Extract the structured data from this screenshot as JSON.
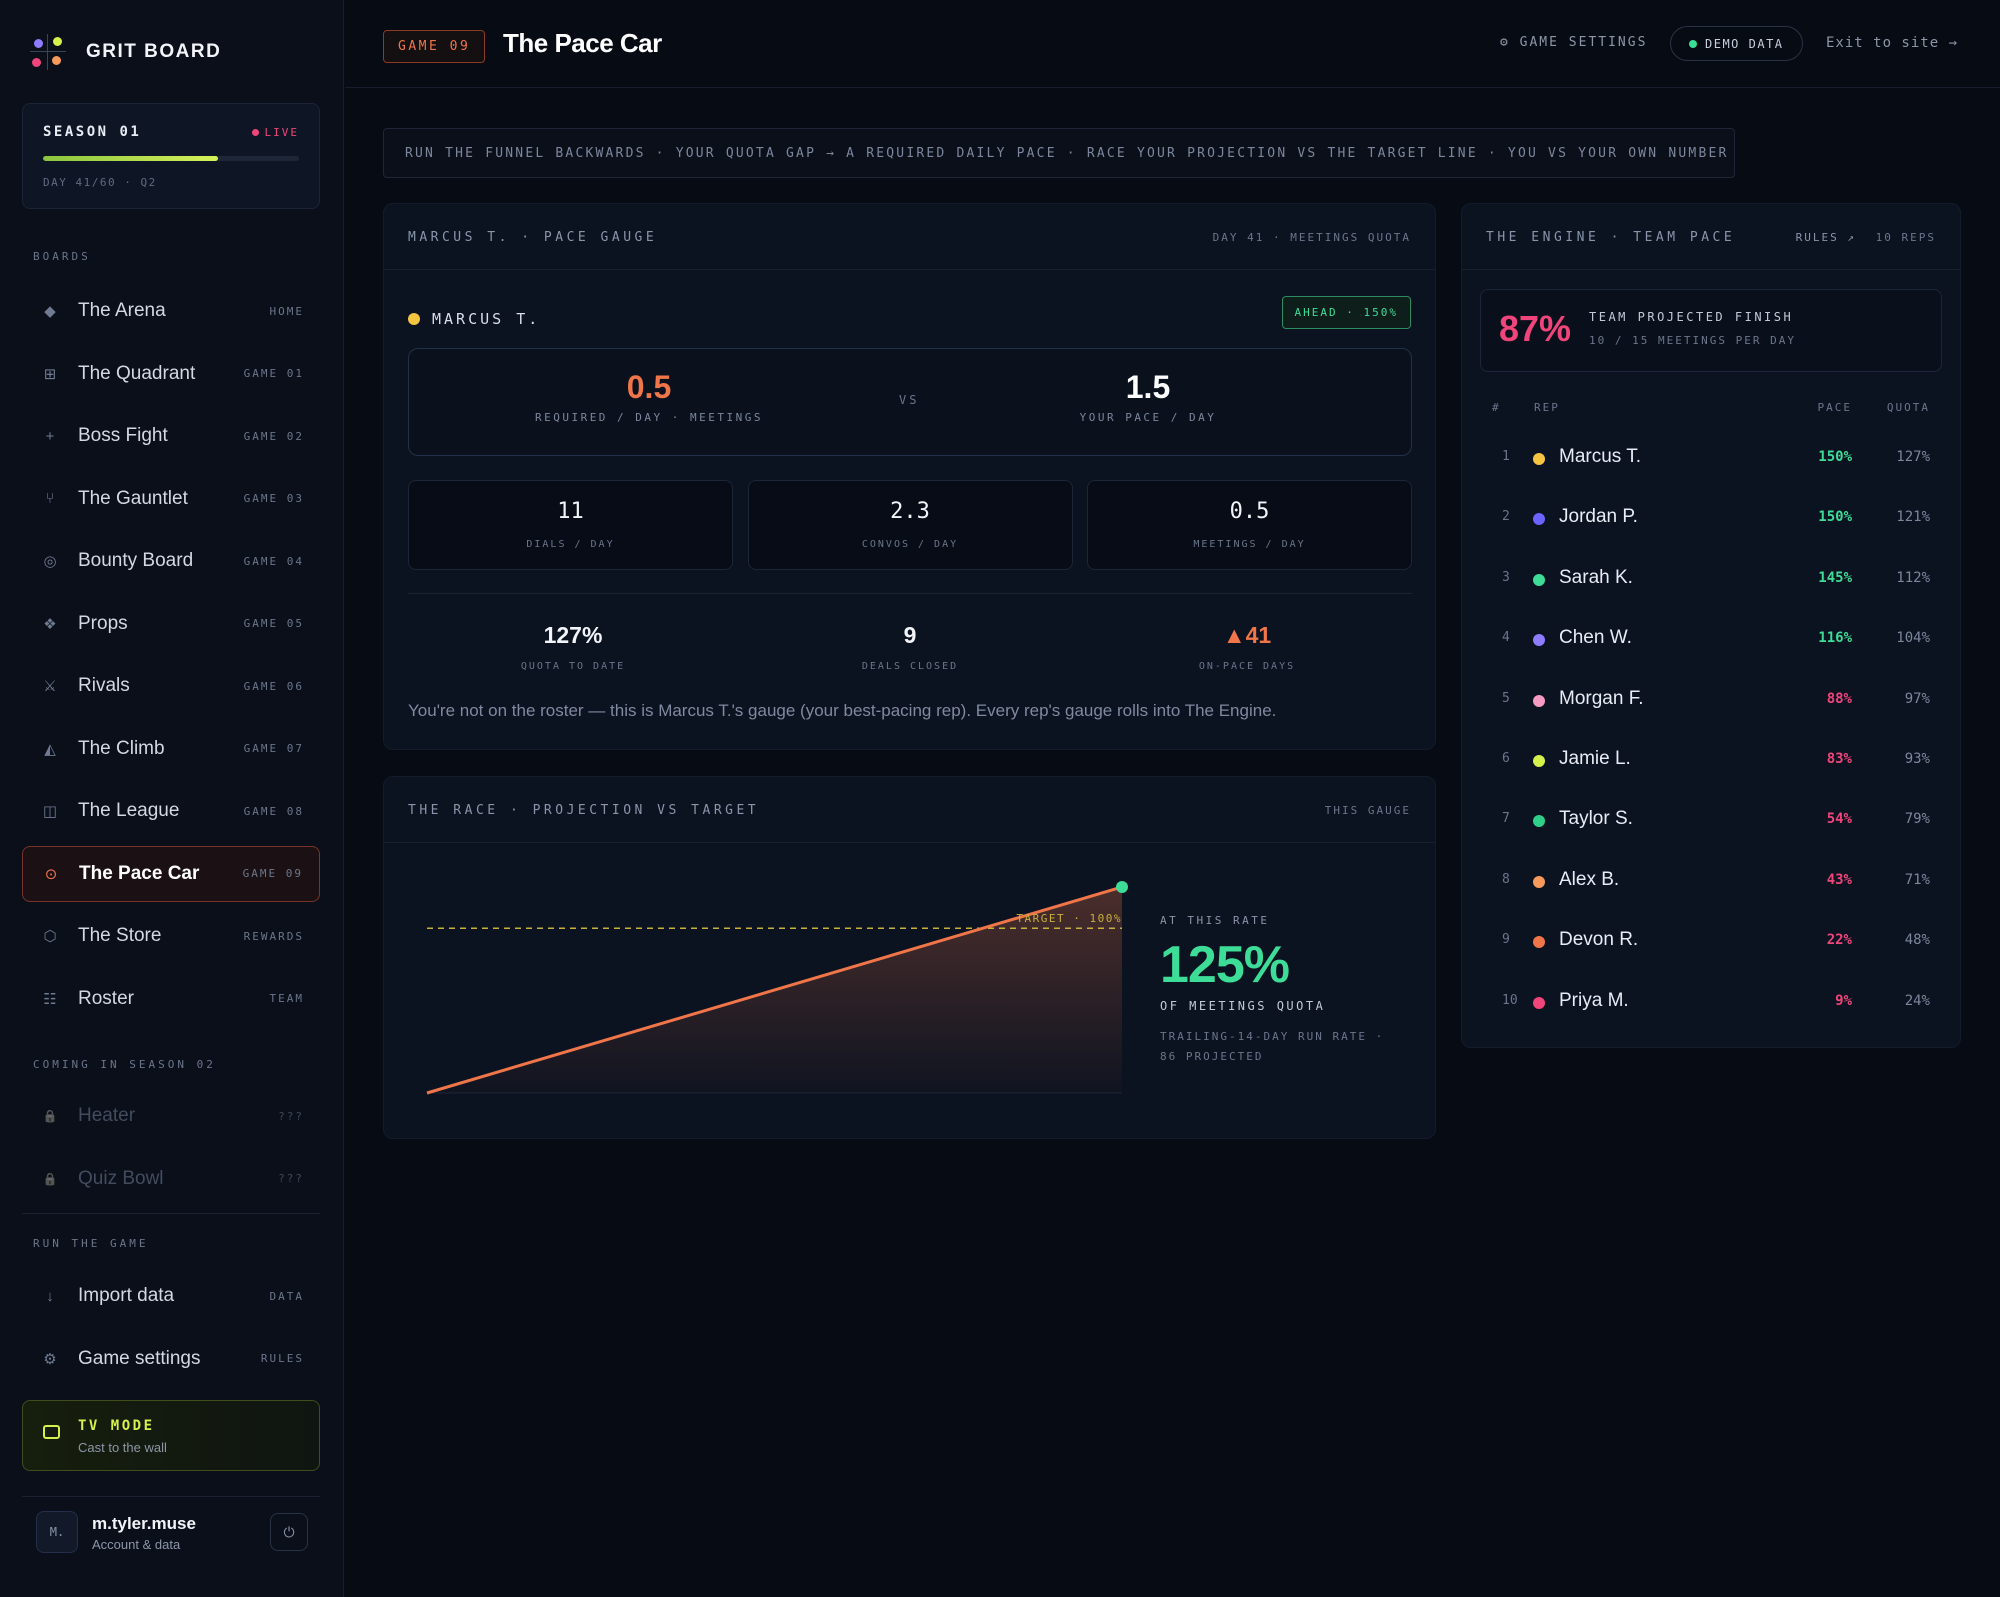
{
  "brand": {
    "name": "GRIT BOARD"
  },
  "season": {
    "title": "SEASON 01",
    "status": "LIVE",
    "progress": 0.683,
    "sub": "DAY 41/60 · Q2"
  },
  "sidebar": {
    "boards_label": "BOARDS",
    "items": [
      {
        "icon": "◆",
        "icon_name": "diamond-icon",
        "label": "The Arena",
        "tag": "HOME"
      },
      {
        "icon": "⊞",
        "icon_name": "grid-icon",
        "label": "The Quadrant",
        "tag": "GAME 01"
      },
      {
        "icon": "+",
        "icon_name": "crosshair-icon",
        "label": "Boss Fight",
        "tag": "GAME 02"
      },
      {
        "icon": "⑂",
        "icon_name": "fork-icon",
        "label": "The Gauntlet",
        "tag": "GAME 03"
      },
      {
        "icon": "◎",
        "icon_name": "target-icon",
        "label": "Bounty Board",
        "tag": "GAME 04"
      },
      {
        "icon": "❖",
        "icon_name": "props-icon",
        "label": "Props",
        "tag": "GAME 05"
      },
      {
        "icon": "⚔",
        "icon_name": "swords-icon",
        "label": "Rivals",
        "tag": "GAME 06"
      },
      {
        "icon": "◭",
        "icon_name": "mountain-icon",
        "label": "The Climb",
        "tag": "GAME 07"
      },
      {
        "icon": "◫",
        "icon_name": "league-icon",
        "label": "The League",
        "tag": "GAME 08"
      },
      {
        "icon": "⊙",
        "icon_name": "speedometer-icon",
        "label": "The Pace Car",
        "tag": "GAME 09"
      },
      {
        "icon": "⬡",
        "icon_name": "store-icon",
        "label": "The Store",
        "tag": "REWARDS"
      },
      {
        "icon": "☷",
        "icon_name": "roster-icon",
        "label": "Roster",
        "tag": "TEAM"
      }
    ],
    "coming_label": "COMING IN SEASON 02",
    "locked": [
      {
        "label": "Heater",
        "tag": "???"
      },
      {
        "label": "Quiz Bowl",
        "tag": "???"
      }
    ],
    "run_label": "RUN THE GAME",
    "run_items": [
      {
        "icon": "↓",
        "icon_name": "download-icon",
        "label": "Import data",
        "tag": "DATA"
      },
      {
        "icon": "⚙",
        "icon_name": "gear-icon",
        "label": "Game settings",
        "tag": "RULES"
      }
    ],
    "tv": {
      "title": "TV MODE",
      "sub": "Cast to the wall"
    },
    "user": {
      "initials": "M.",
      "name": "m.tyler.muse",
      "sub": "Account & data"
    }
  },
  "topbar": {
    "game_badge": "GAME 09",
    "title": "The Pace Car",
    "settings": "⚙ GAME SETTINGS",
    "demo": "DEMO DATA",
    "exit": "Exit to site →"
  },
  "banner": "RUN THE FUNNEL BACKWARDS · YOUR QUOTA GAP → A REQUIRED DAILY PACE · RACE YOUR PROJECTION VS THE TARGET LINE · YOU VS YOUR OWN NUMBER",
  "gauge": {
    "title": "MARCUS T. · PACE GAUGE",
    "meta": "DAY 41 · MEETINGS QUOTA",
    "rep": "MARCUS T.",
    "rep_color": "#f5c542",
    "status": "AHEAD · 150%",
    "required": "0.5",
    "required_label": "REQUIRED / DAY · MEETINGS",
    "vs": "VS",
    "your_pace": "1.5",
    "your_pace_label": "YOUR PACE / DAY",
    "funnel": [
      {
        "value": "11",
        "label": "DIALS / DAY"
      },
      {
        "value": "2.3",
        "label": "CONVOS / DAY"
      },
      {
        "value": "0.5",
        "label": "MEETINGS / DAY"
      }
    ],
    "stats": [
      {
        "value": "127%",
        "label": "QUOTA TO DATE"
      },
      {
        "value": "9",
        "label": "DEALS CLOSED"
      },
      {
        "value": "▲41",
        "label": "ON-PACE DAYS"
      }
    ],
    "note": "You're not on the roster — this is Marcus T.'s gauge (your best-pacing rep). Every rep's gauge rolls into The Engine."
  },
  "race": {
    "title": "THE RACE · PROJECTION VS TARGET",
    "meta": "THIS GAUGE",
    "target_label": "TARGET · 100%",
    "rate_label": "AT THIS RATE",
    "rate_value": "125%",
    "rate_sub": "OF MEETINGS QUOTA",
    "rate_note1": "TRAILING-14-DAY RUN RATE ·",
    "rate_note2": "86 PROJECTED"
  },
  "chart_data": {
    "type": "line",
    "series": [
      {
        "x": [
          0,
          1
        ],
        "y": [
          0,
          125
        ]
      }
    ],
    "target": 100,
    "ylim": [
      0,
      125
    ]
  },
  "engine": {
    "title": "THE ENGINE · TEAM PACE",
    "rules": "RULES ↗",
    "reps_count": "10 REPS",
    "team_pct": "87%",
    "team_title": "TEAM PROJECTED FINISH",
    "team_sub": "10 / 15 MEETINGS PER DAY",
    "cols": {
      "num": "#",
      "rep": "REP",
      "pace": "PACE",
      "quota": "QUOTA"
    },
    "reps": [
      {
        "n": "1",
        "name": "Marcus T.",
        "color": "#f5c542",
        "pace": "150%",
        "quota": "127%",
        "good": true
      },
      {
        "n": "2",
        "name": "Jordan P.",
        "color": "#6c63ff",
        "pace": "150%",
        "quota": "121%",
        "good": true
      },
      {
        "n": "3",
        "name": "Sarah K.",
        "color": "#3ddc97",
        "pace": "145%",
        "quota": "112%",
        "good": true
      },
      {
        "n": "4",
        "name": "Chen W.",
        "color": "#8f7bff",
        "pace": "116%",
        "quota": "104%",
        "good": true
      },
      {
        "n": "5",
        "name": "Morgan F.",
        "color": "#f59ac0",
        "pace": "88%",
        "quota": "97%",
        "good": false
      },
      {
        "n": "6",
        "name": "Jamie L.",
        "color": "#d6f04c",
        "pace": "83%",
        "quota": "93%",
        "good": false
      },
      {
        "n": "7",
        "name": "Taylor S.",
        "color": "#2fcf8a",
        "pace": "54%",
        "quota": "79%",
        "good": false
      },
      {
        "n": "8",
        "name": "Alex B.",
        "color": "#f59a5a",
        "pace": "43%",
        "quota": "71%",
        "good": false
      },
      {
        "n": "9",
        "name": "Devon R.",
        "color": "#f0764a",
        "pace": "22%",
        "quota": "48%",
        "good": false
      },
      {
        "n": "10",
        "name": "Priya M.",
        "color": "#f0457a",
        "pace": "9%",
        "quota": "24%",
        "good": false
      }
    ]
  },
  "colors": {
    "good": "#3ddc97",
    "bad": "#f0457a",
    "accent": "#f0764a"
  }
}
